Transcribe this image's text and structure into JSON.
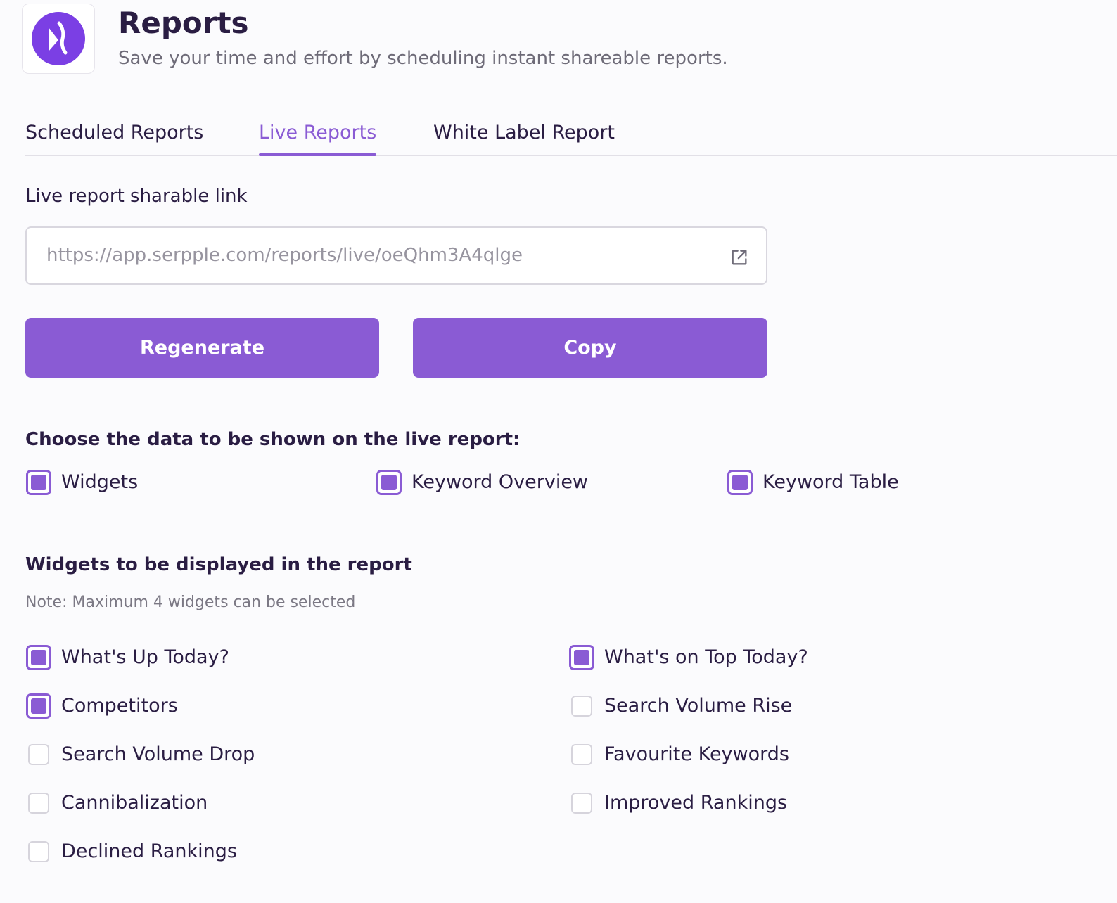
{
  "header": {
    "title": "Reports",
    "subtitle": "Save your time and effort by scheduling instant shareable reports."
  },
  "tabs": [
    {
      "label": "Scheduled Reports",
      "active": false
    },
    {
      "label": "Live Reports",
      "active": true
    },
    {
      "label": "White Label Report",
      "active": false
    }
  ],
  "live_link": {
    "label": "Live report sharable link",
    "url": "https://app.serpple.com/reports/live/oeQhm3A4qlge"
  },
  "actions": {
    "regenerate_label": "Regenerate",
    "copy_label": "Copy"
  },
  "data_section": {
    "heading": "Choose the data to be shown on the live report:",
    "options": [
      {
        "label": "Widgets",
        "checked": true
      },
      {
        "label": "Keyword Overview",
        "checked": true
      },
      {
        "label": "Keyword Table",
        "checked": true
      }
    ]
  },
  "widgets_section": {
    "heading": "Widgets to be displayed in the report",
    "note": "Note: Maximum 4 widgets can be selected",
    "items": [
      {
        "label": "What's Up Today?",
        "checked": true
      },
      {
        "label": "What's on Top Today?",
        "checked": true
      },
      {
        "label": "Competitors",
        "checked": true
      },
      {
        "label": "Search Volume Rise",
        "checked": false
      },
      {
        "label": "Search Volume Drop",
        "checked": false
      },
      {
        "label": "Favourite Keywords",
        "checked": false
      },
      {
        "label": "Cannibalization",
        "checked": false
      },
      {
        "label": "Improved Rankings",
        "checked": false
      },
      {
        "label": "Declined Rankings",
        "checked": false
      }
    ]
  },
  "colors": {
    "accent": "#8a5bd4",
    "logo": "#7b3fe4",
    "text": "#2a1d43"
  },
  "icons": {
    "logo": "serpple-logo-icon",
    "open_link": "external-link-icon"
  }
}
